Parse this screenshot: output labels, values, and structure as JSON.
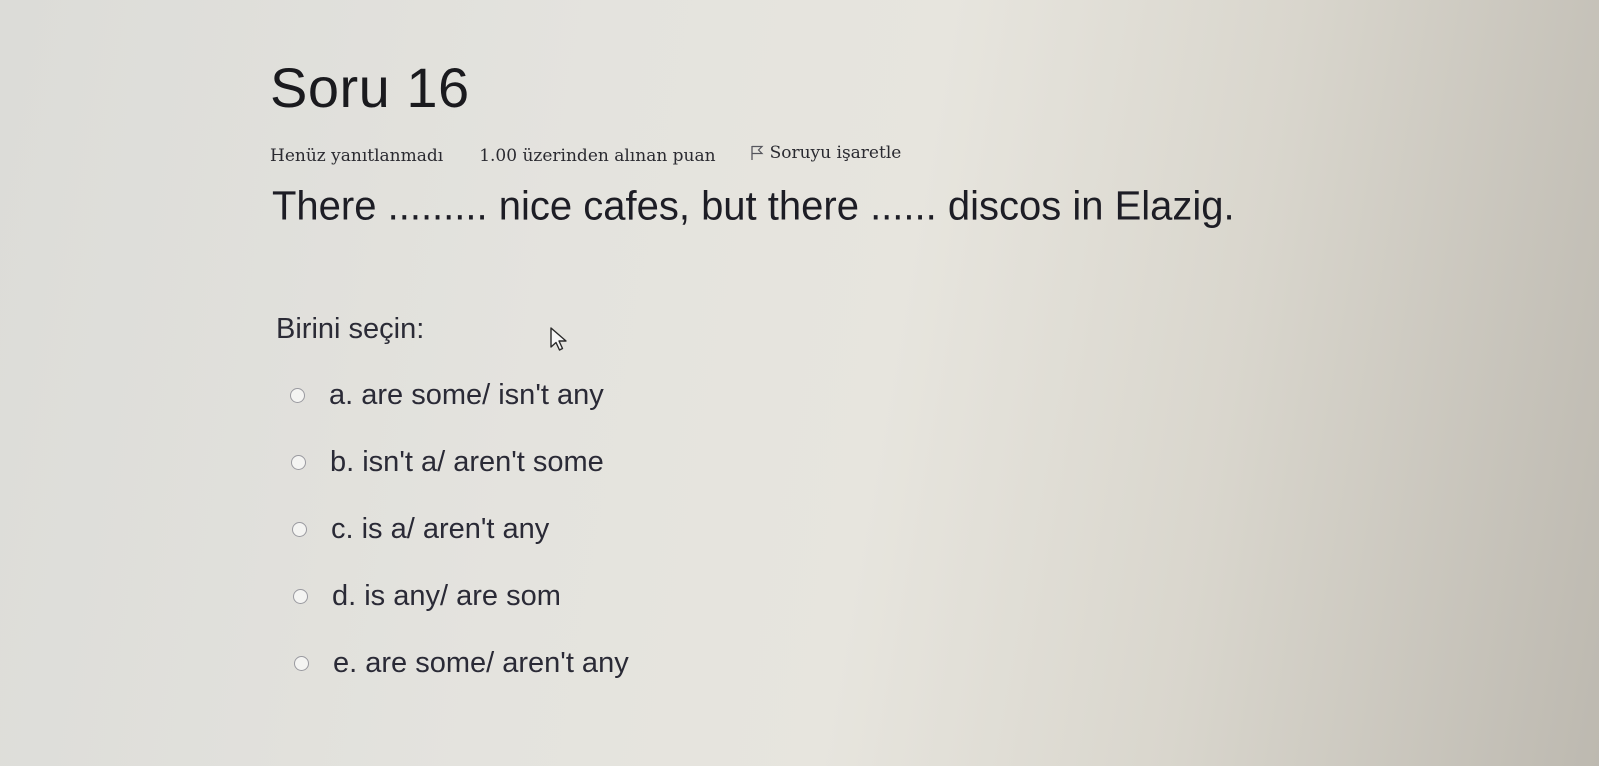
{
  "question": {
    "title": "Soru 16",
    "state": "Henüz yanıtlanmadı",
    "grade": "1.00 üzerinden alınan puan",
    "flag_label": "Soruyu işaretle",
    "text": "There ......... nice cafes, but there ...... discos in Elazig."
  },
  "prompt": "Birini seçin:",
  "answers": [
    {
      "label": "a. are some/ isn't any",
      "selected": false
    },
    {
      "label": "b. isn't a/ aren't some",
      "selected": false
    },
    {
      "label": "c. is a/ aren't any",
      "selected": false
    },
    {
      "label": "d. is any/ are som",
      "selected": false
    },
    {
      "label": "e. are some/ aren't any",
      "selected": false
    }
  ],
  "icons": {
    "flag": "flag-icon",
    "radio": "radio-button-icon",
    "cursor": "mouse-pointer-icon"
  }
}
